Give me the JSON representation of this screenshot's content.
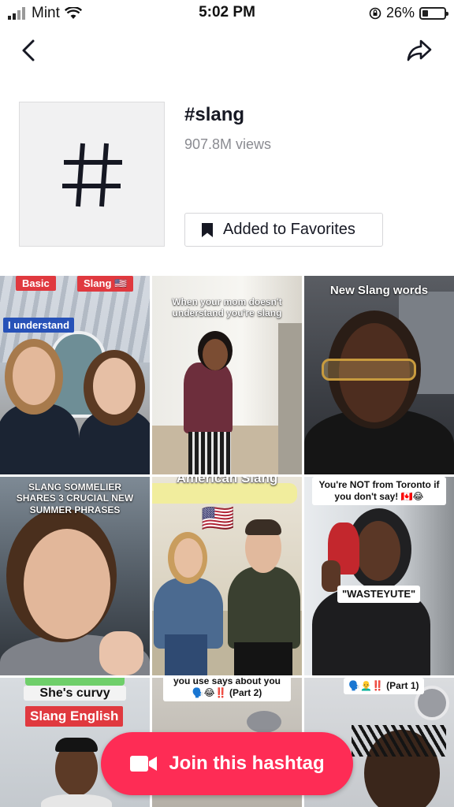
{
  "status_bar": {
    "carrier": "Mint",
    "time": "5:02 PM",
    "battery_percent": "26%",
    "battery_level": 0.26
  },
  "nav": {
    "back_icon": "chevron-left-icon",
    "share_icon": "share-arrow-icon"
  },
  "hashtag": {
    "name": "#slang",
    "views": "907.8M views",
    "thumbnail_glyph": "#",
    "favorite_label": "Added to Favorites"
  },
  "videos": [
    {
      "labels": [
        "Basic",
        "Slang 🇺🇸",
        "I understand"
      ]
    },
    {
      "caption": "When your mom doesn't understand you're slang"
    },
    {
      "caption": "New Slang words"
    },
    {
      "caption": "SLANG SOMMELIER SHARES 3 CRUCIAL NEW SUMMER PHRASES"
    },
    {
      "caption": "American Slang",
      "flag": "🇺🇸"
    },
    {
      "caption": "You're NOT from Toronto if you don't say! 🇨🇦😂",
      "sub_caption": "\"WASTEYUTE\""
    },
    {
      "caption": "She's curvy",
      "label": "Slang English"
    },
    {
      "caption": "you use says about you 🗣️😂‼️ (Part 2)"
    },
    {
      "caption": "🗣️👨‍🦲‼️ (Part 1)"
    }
  ],
  "join_button": {
    "label": "Join this hashtag",
    "icon": "video-camera-icon"
  },
  "colors": {
    "accent": "#fe2c55",
    "label_red": "#e0393f",
    "label_blue": "#2752b8",
    "muted_text": "#8a8b91"
  }
}
